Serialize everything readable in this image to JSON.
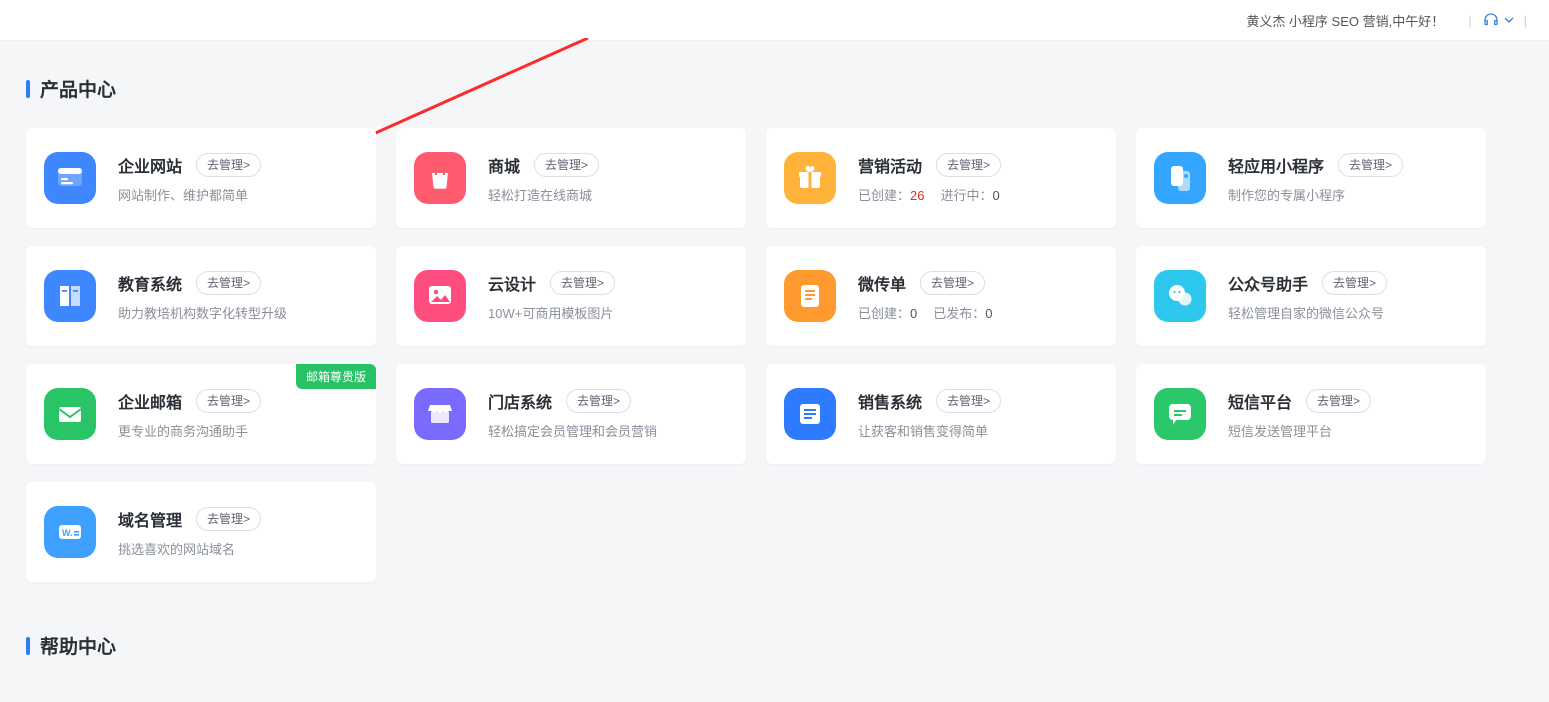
{
  "top": {
    "greeting": "黄义杰  小程序  SEO  营销,中午好！"
  },
  "section": {
    "title": "产品中心"
  },
  "section2": {
    "title": "帮助中心"
  },
  "pill": "去管理>",
  "badge_mail": "邮箱尊贵版",
  "cards": [
    {
      "key": "site",
      "title": "企业网站",
      "desc": "网站制作、维护都简单",
      "iconBg": "#3f87ff",
      "icon": "site"
    },
    {
      "key": "mall",
      "title": "商城",
      "desc": "轻松打造在线商城",
      "iconBg": "#ff5b6e",
      "icon": "bag"
    },
    {
      "key": "marketing",
      "title": "营销活动",
      "stat1_label": "已创建：",
      "stat1_value": "26",
      "stat1_red": true,
      "stat2_label": "进行中：",
      "stat2_value": "0",
      "iconBg": "#ffb33a",
      "icon": "gift"
    },
    {
      "key": "miniapp",
      "title": "轻应用小程序",
      "desc": "制作您的专属小程序",
      "iconBg": "#34a6ff",
      "icon": "mini"
    },
    {
      "key": "edu",
      "title": "教育系统",
      "desc": "助力教培机构数字化转型升级",
      "iconBg": "#3f87ff",
      "icon": "book"
    },
    {
      "key": "design",
      "title": "云设计",
      "desc": "10W+可商用模板图片",
      "iconBg": "#ff4d7d",
      "icon": "image"
    },
    {
      "key": "flyer",
      "title": "微传单",
      "stat1_label": "已创建：",
      "stat1_value": "0",
      "stat2_label": "已发布：",
      "stat2_value": "0",
      "iconBg": "#ff9a2e",
      "icon": "doc"
    },
    {
      "key": "mp",
      "title": "公众号助手",
      "desc": "轻松管理自家的微信公众号",
      "iconBg": "#2ec8ef",
      "icon": "wechat"
    },
    {
      "key": "mail",
      "title": "企业邮箱",
      "desc": "更专业的商务沟通助手",
      "iconBg": "#29c466",
      "icon": "mail",
      "badge": true
    },
    {
      "key": "store",
      "title": "门店系统",
      "desc": "轻松搞定会员管理和会员营销",
      "iconBg": "#7a6bff",
      "icon": "store"
    },
    {
      "key": "sales",
      "title": "销售系统",
      "desc": "让获客和销售变得简单",
      "iconBg": "#2f7bff",
      "icon": "list"
    },
    {
      "key": "sms",
      "title": "短信平台",
      "desc": "短信发送管理平台",
      "iconBg": "#2bc86b",
      "icon": "sms"
    },
    {
      "key": "domain",
      "title": "域名管理",
      "desc": "挑选喜欢的网站域名",
      "iconBg": "#3fa1ff",
      "icon": "domain"
    }
  ]
}
